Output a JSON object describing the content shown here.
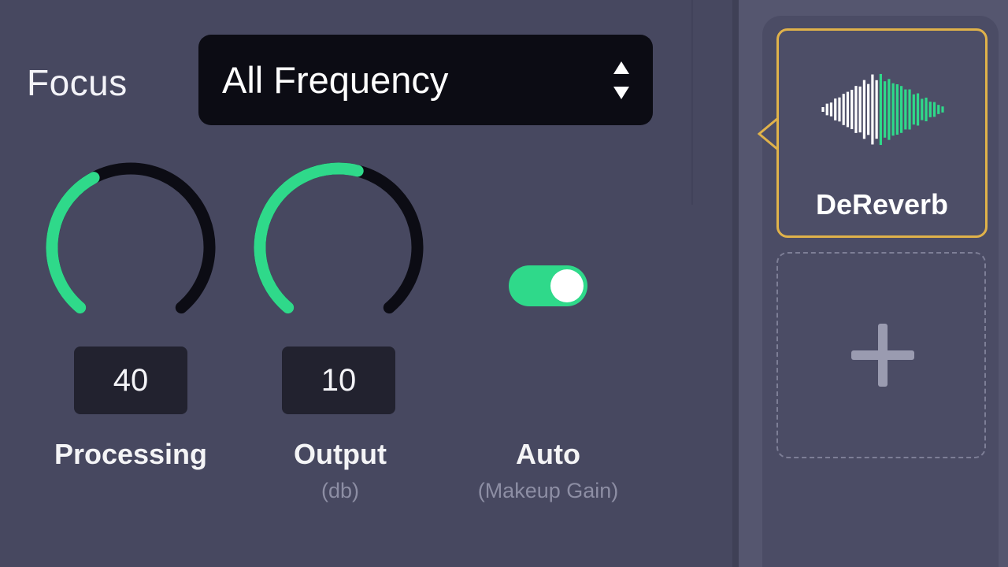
{
  "focus": {
    "label": "Focus",
    "selected": "All Frequency"
  },
  "controls": {
    "processing": {
      "value": "40",
      "label": "Processing",
      "level": 0.4
    },
    "output": {
      "value": "10",
      "label": "Output",
      "sublabel": "(db)",
      "level": 0.55
    },
    "auto": {
      "label": "Auto",
      "sublabel": "(Makeup Gain)",
      "enabled": true
    }
  },
  "sidebar": {
    "effect": {
      "label": "DeReverb",
      "icon": "waveform-icon"
    },
    "add": {
      "icon": "plus-icon"
    }
  },
  "colors": {
    "accent": "#2fd98a",
    "selected_border": "#e0b24a",
    "knob_track": "#0c0c14"
  }
}
